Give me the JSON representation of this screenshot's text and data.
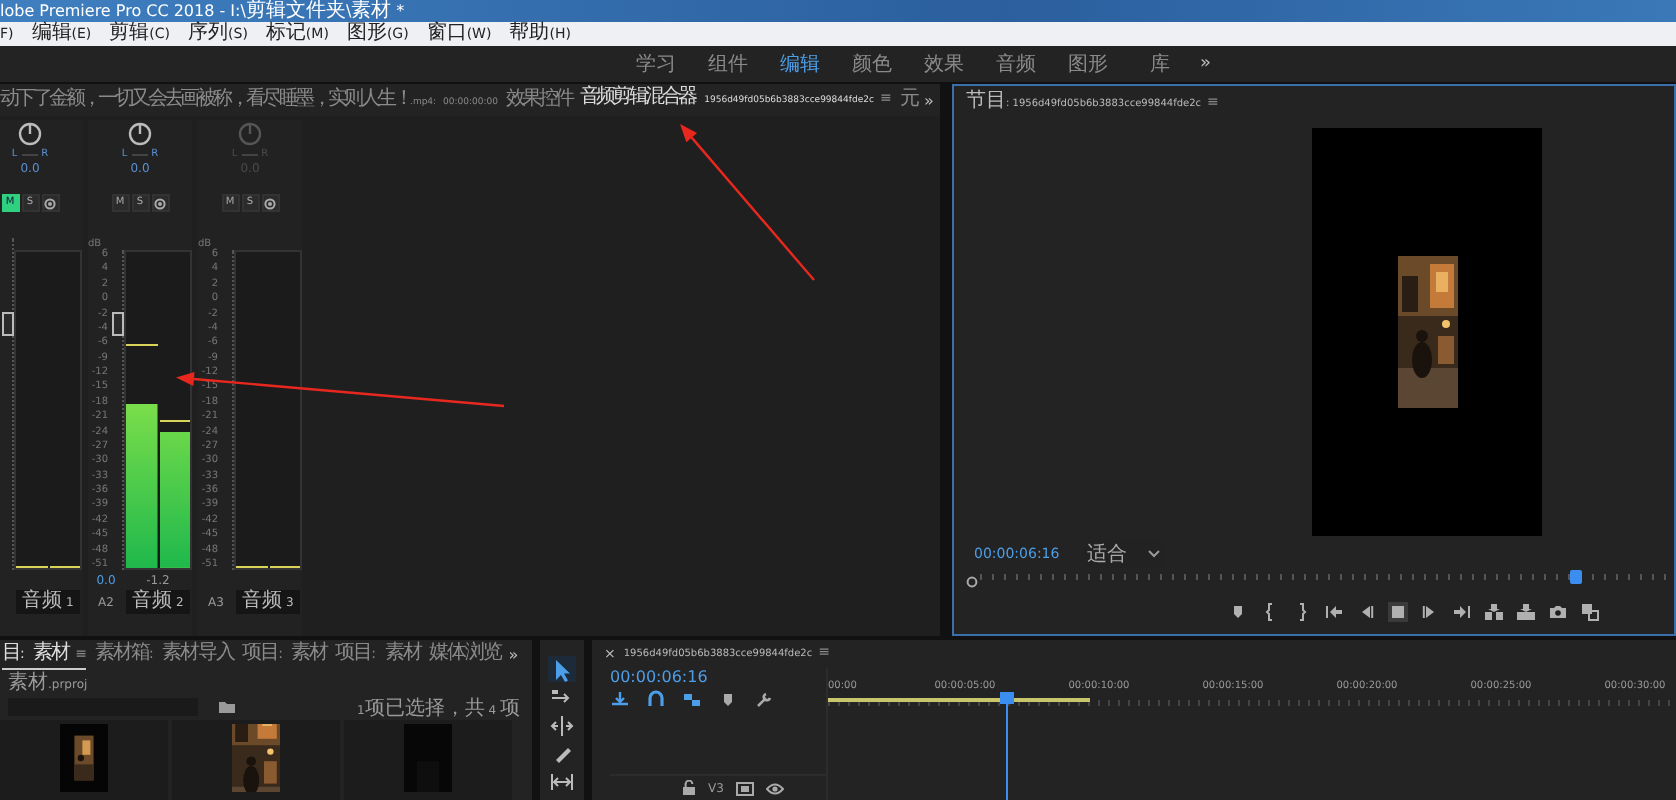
{
  "title_bar": {
    "title": "lobe Premiere Pro CC 2018 - I:\\剪辑文件夹\\素材 *"
  },
  "menu": [
    "F)",
    "编辑(E)",
    "剪辑(C)",
    "序列(S)",
    "标记(M)",
    "图形(G)",
    "窗口(W)",
    "帮助(H)"
  ],
  "workspaces": {
    "items": [
      {
        "label": "学习",
        "selected": false
      },
      {
        "label": "组件",
        "selected": false
      },
      {
        "label": "编辑",
        "selected": true
      },
      {
        "label": "颜色",
        "selected": false
      },
      {
        "label": "效果",
        "selected": false
      },
      {
        "label": "音频",
        "selected": false
      },
      {
        "label": "图形",
        "selected": false
      },
      {
        "label": "库",
        "selected": false
      }
    ],
    "more": "»"
  },
  "source_panel": {
    "tabs": [
      {
        "label": "动下了金额，一切又会去画被称，看尽睡墨，实则人生！.mp4: 00:00:00:00",
        "selected": false
      },
      {
        "label": "效果控件",
        "selected": false
      },
      {
        "label": "音频剪辑混合器: 1956d49fd05b6b3883cce99844fde2c",
        "selected": true,
        "menu": "≡"
      },
      {
        "label": "元",
        "selected": false
      }
    ],
    "more": "»"
  },
  "mixer": {
    "strips": [
      {
        "disabled": false,
        "pan": {
          "left": "L",
          "right": "R",
          "value": "0.0"
        },
        "mute": {
          "label": "M",
          "on": true
        },
        "solo": {
          "label": "S",
          "on": false
        },
        "fader": {
          "level": 0.74
        },
        "meters": [
          {
            "level": 0,
            "peak": {
              "level": 0
            }
          },
          {
            "level": 0,
            "peak": {
              "level": 0
            }
          }
        ],
        "name": "音频 1"
      },
      {
        "disabled": false,
        "pan": {
          "left": "L",
          "right": "R",
          "value": "0.0"
        },
        "mute": {
          "label": "M",
          "on": false
        },
        "solo": {
          "label": "S",
          "on": false
        },
        "fader": {
          "level": 0.74
        },
        "scale_unit": "dB",
        "scale": [
          "6",
          "4",
          "2",
          "0",
          "-2",
          "-4",
          "-6",
          "-9",
          "-12",
          "-15",
          "-18",
          "-21",
          "-24",
          "-27",
          "-30",
          "-33",
          "-36",
          "-39",
          "-42",
          "-45",
          "-48",
          "-51"
        ],
        "meters": [
          {
            "level": 0.52,
            "peak": {
              "level": 0.7
            }
          },
          {
            "level": 0.43,
            "peak": {
              "level": 0.46
            }
          }
        ],
        "volume": "0.0",
        "peak_reading": "-1.2",
        "track": "A2",
        "name": "音频 2"
      },
      {
        "disabled": true,
        "pan": {
          "left": "L",
          "right": "R",
          "value": "0.0"
        },
        "mute": {
          "label": "M",
          "on": false
        },
        "solo": {
          "label": "S",
          "on": false
        },
        "scale_unit": "dB",
        "scale": [
          "6",
          "4",
          "2",
          "0",
          "-2",
          "-4",
          "-6",
          "-9",
          "-12",
          "-15",
          "-18",
          "-21",
          "-24",
          "-27",
          "-30",
          "-33",
          "-36",
          "-39",
          "-42",
          "-45",
          "-48",
          "-51"
        ],
        "meters": [
          {
            "level": 0,
            "peak": {
              "level": 0
            }
          },
          {
            "level": 0,
            "peak": {
              "level": 0
            }
          }
        ],
        "track": "A3",
        "name": "音频 3"
      }
    ]
  },
  "program": {
    "tab": {
      "label": "节目: 1956d49fd05b6b3883cce99844fde2c",
      "menu": "≡"
    },
    "timecode": "00:00:06:16",
    "zoom": "适合",
    "scrubber": {
      "level": 0.86
    },
    "transport": [
      {
        "kind": "marker"
      },
      {
        "kind": "mark-in"
      },
      {
        "kind": "mark-out"
      },
      {
        "kind": "go-to-in"
      },
      {
        "kind": "step-back"
      },
      {
        "kind": "stop"
      },
      {
        "kind": "step-forward"
      },
      {
        "kind": "go-to-out"
      },
      {
        "kind": "insert"
      },
      {
        "kind": "overwrite"
      },
      {
        "kind": "camera"
      },
      {
        "kind": "button-editor"
      }
    ]
  },
  "project": {
    "tabs": [
      {
        "label": "目: 素材",
        "selected": true,
        "menu": "≡"
      },
      {
        "label": "素材箱: 素材导入",
        "selected": false
      },
      {
        "label": "项目: 素材",
        "selected": false
      },
      {
        "label": "项目: 素材",
        "selected": false
      },
      {
        "label": "媒体浏览",
        "selected": false
      }
    ],
    "more": "»",
    "file": "素材.prproj",
    "selection_info": "1项已选择，共 4 项",
    "items": [
      {
        "kind": "dark-photo"
      },
      {
        "kind": "street"
      },
      {
        "kind": "dark-red"
      }
    ]
  },
  "tools": [
    {
      "kind": "selection",
      "selected": true
    },
    {
      "kind": "track-select",
      "selected": false
    },
    {
      "kind": "ripple",
      "selected": false
    },
    {
      "kind": "razor",
      "selected": false
    },
    {
      "kind": "slip",
      "selected": false
    }
  ],
  "timeline": {
    "tab": {
      "close": "×",
      "label": "1956d49fd05b6b3883cce99844fde2c",
      "menu": "≡"
    },
    "timecode": "00:00:06:16",
    "toolbar": [
      {
        "kind": "nest"
      },
      {
        "kind": "snap"
      },
      {
        "kind": "linked"
      },
      {
        "kind": "marker"
      },
      {
        "kind": "wrench"
      }
    ],
    "ruler": [
      "00:00",
      "00:00:05:00",
      "00:00:10:00",
      "00:00:15:00",
      "00:00:20:00",
      "00:00:25:00",
      "00:00:30:00"
    ],
    "work_area": {
      "level": 0.31
    },
    "playhead": {
      "level": 0.21
    },
    "tracks": [
      {
        "label": "V3"
      }
    ]
  },
  "annotations": [
    {
      "kind": "arrow"
    },
    {
      "kind": "arrow"
    }
  ]
}
